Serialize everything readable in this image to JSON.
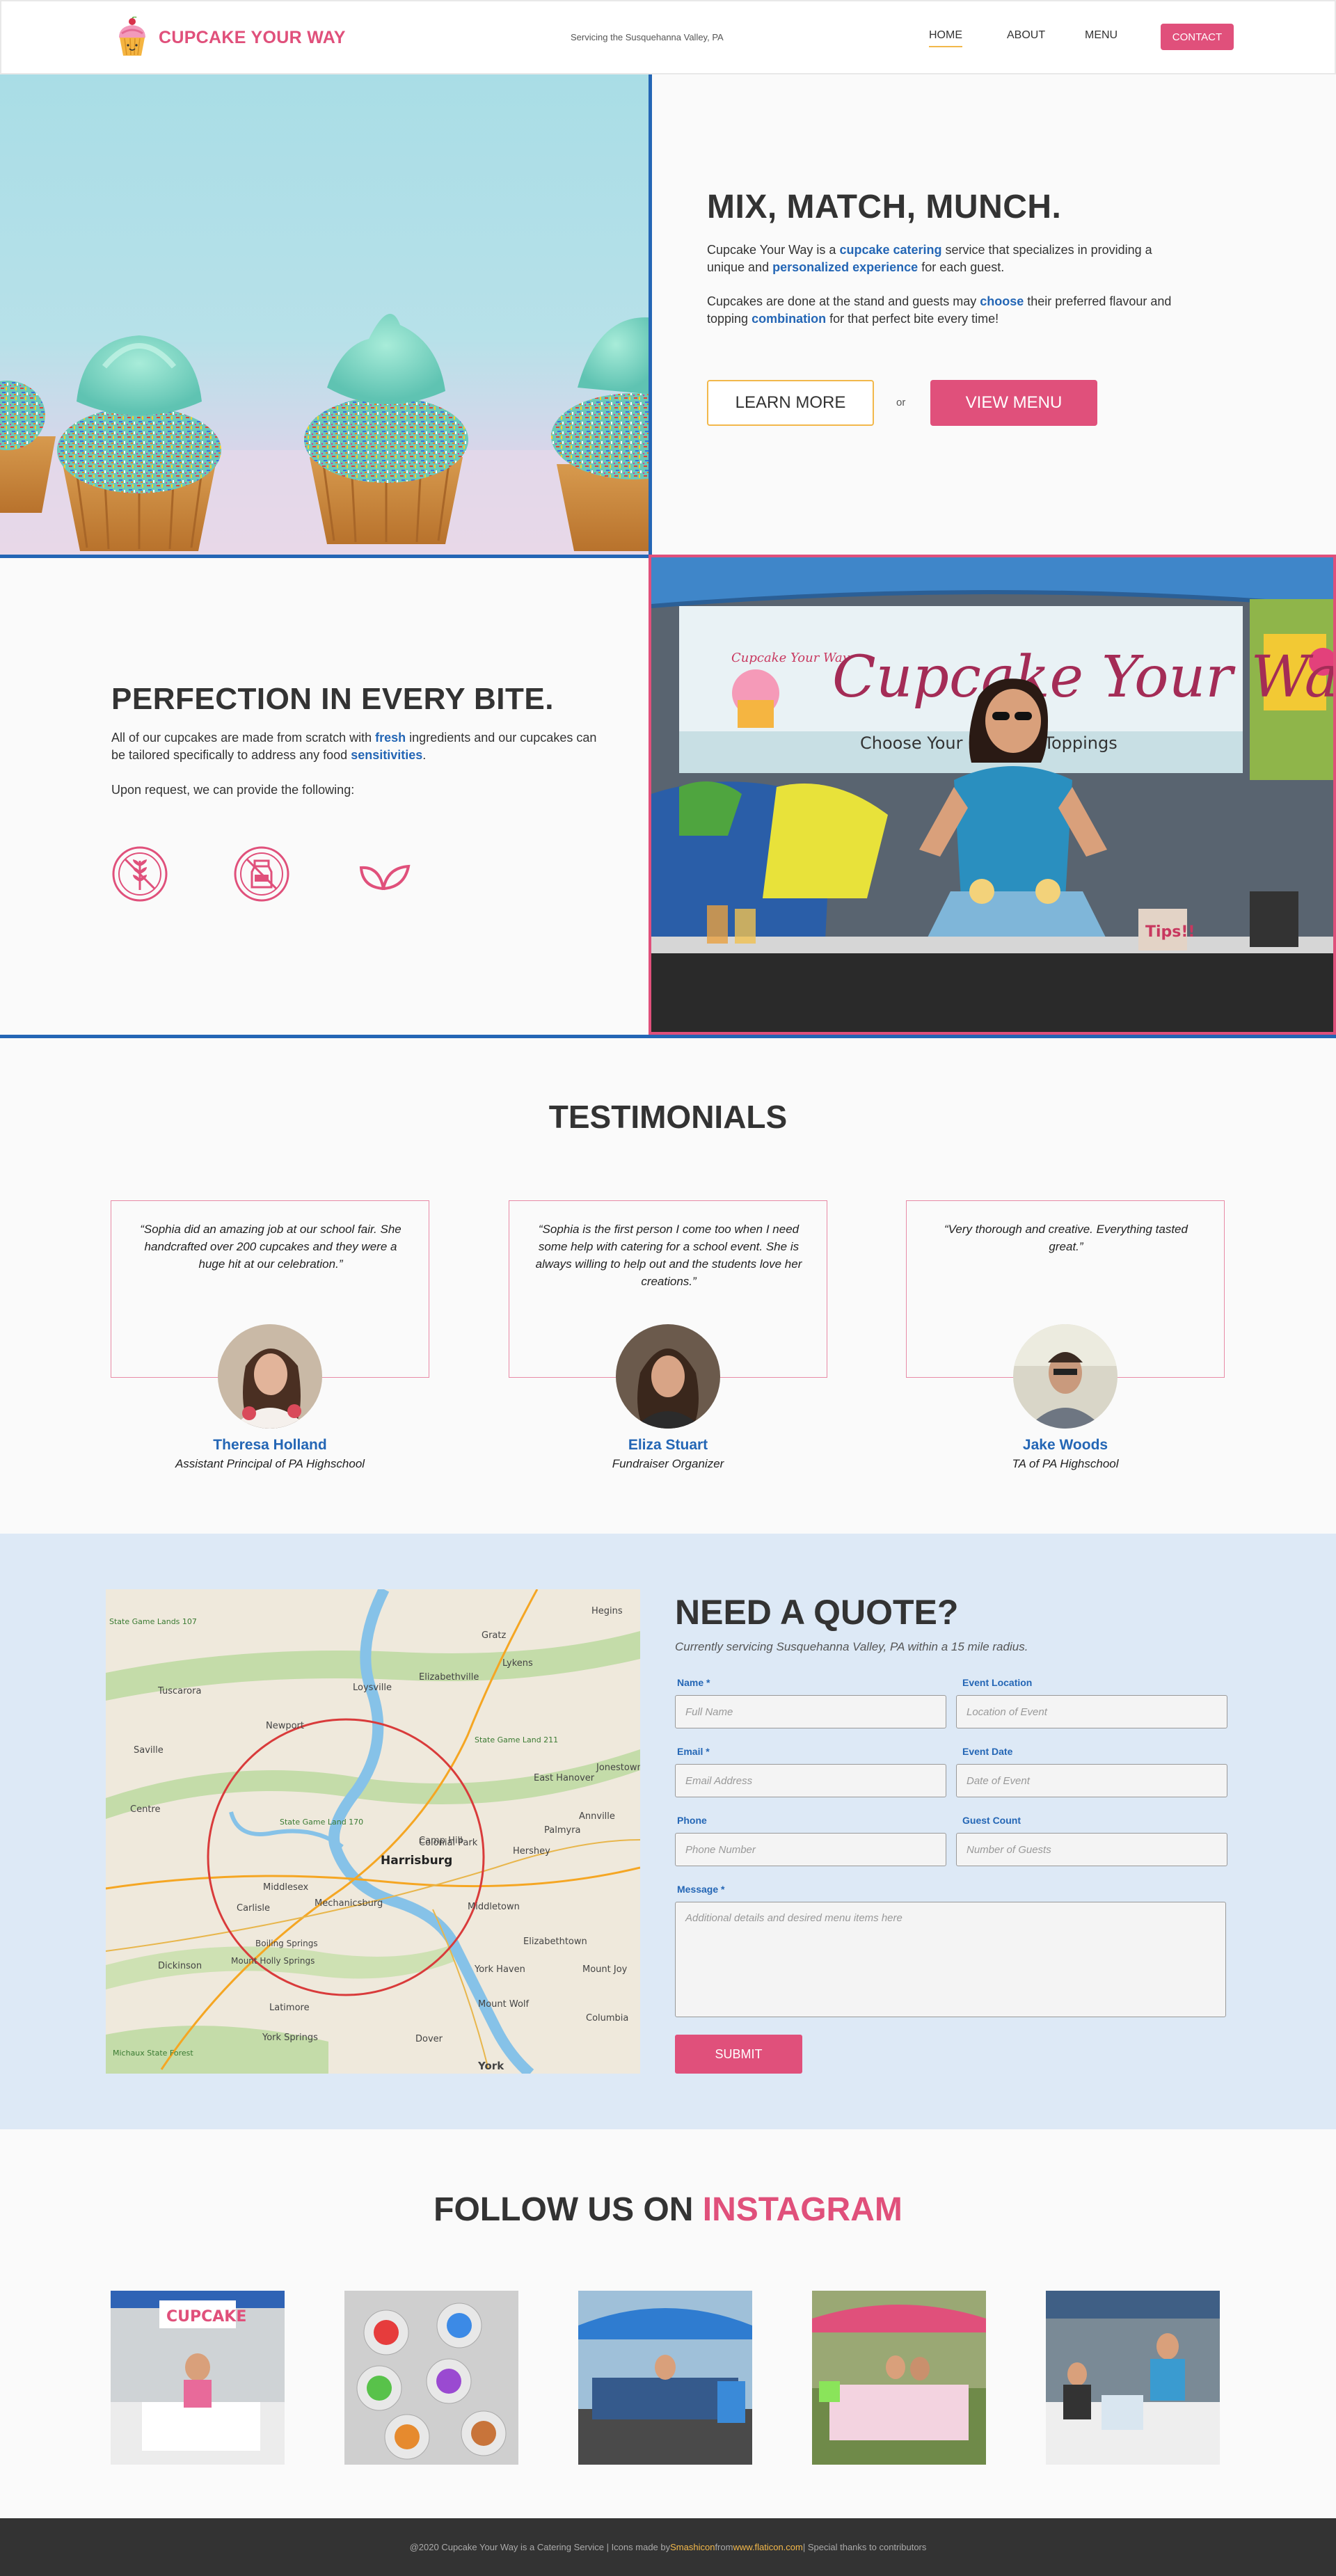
{
  "header": {
    "brand": "CUPCAKE YOUR WAY",
    "tagline": "Servicing the Susquehanna Valley, PA",
    "nav": {
      "home": "HOME",
      "about": "ABOUT",
      "menu": "MENU",
      "contact": "CONTACT"
    }
  },
  "hero": {
    "title": "MIX, MATCH, MUNCH.",
    "p1": {
      "t1": "Cupcake Your Way is a ",
      "h1": "cupcake catering",
      "t2": " service that specializes in providing a unique and ",
      "h2": "personalized experience",
      "t3": " for each guest."
    },
    "p2": {
      "t1": "Cupcakes are done at the stand and guests may ",
      "h1": "choose",
      "t2": " their preferred flavour and topping ",
      "h2": "combination",
      "t3": " for that perfect bite every time!"
    },
    "learn_more": "LEARN MORE",
    "or": "or",
    "view_menu": "VIEW MENU"
  },
  "perfection": {
    "title": "PERFECTION IN EVERY BITE.",
    "p1": {
      "t1": "All of our cupcakes are made from scratch with ",
      "h1": "fresh",
      "t2": " ingredients and our cupcakes can be tailored specifically to address any food ",
      "h2": "sensitivities",
      "t3": "."
    },
    "p2": "Upon request, we can provide the following:",
    "icons": [
      "gluten-free-icon",
      "dairy-free-icon",
      "vegan-leaf-icon"
    ],
    "banner_logo_text": "Cupcake Your Way",
    "banner_script": "Cupcake Your Way",
    "banner_line": "Choose Your Flavor + Toppings"
  },
  "testimonials": {
    "title": "TESTIMONIALS",
    "items": [
      {
        "quote": "“Sophia did an amazing job at our school fair. She handcrafted over 200 cupcakes and they were a huge hit at our celebration.”",
        "name": "Theresa Holland",
        "role": "Assistant Principal of PA Highschool"
      },
      {
        "quote": "“Sophia is the first person I come too when I need some help with catering for a school event. She is always willing to help out and the students love her creations.”",
        "name": "Eliza Stuart",
        "role": "Fundraiser Organizer"
      },
      {
        "quote": "“Very thorough and creative. Everything tasted great.”",
        "name": "Jake Woods",
        "role": "TA of PA Highschool"
      }
    ]
  },
  "quote": {
    "title": "NEED A QUOTE?",
    "subtitle": "Currently servicing Susquehanna Valley, PA within a 15 mile radius.",
    "fields": {
      "name": {
        "label": "Name *",
        "placeholder": "Full Name"
      },
      "location": {
        "label": "Event Location",
        "placeholder": "Location of Event"
      },
      "email": {
        "label": "Email *",
        "placeholder": "Email Address"
      },
      "date": {
        "label": "Event Date",
        "placeholder": "Date of Event"
      },
      "phone": {
        "label": "Phone",
        "placeholder": "Phone Number"
      },
      "guests": {
        "label": "Guest Count",
        "placeholder": "Number of Guests"
      },
      "message": {
        "label": "Message *",
        "placeholder": "Additional details and desired menu items here"
      }
    },
    "submit": "SUBMIT",
    "map_labels": [
      "Harrisburg",
      "Hershey",
      "Camp Hill",
      "Mechanicsburg",
      "Carlisle",
      "Middlesex",
      "Newport",
      "Elizabethville",
      "Lykens",
      "Gratz",
      "Hegins",
      "Tuscarora",
      "Saville",
      "Centre",
      "Loysville",
      "East Hanover",
      "Jonestown",
      "Palmyra",
      "Annville",
      "Colonial Park",
      "Middletown",
      "Elizabethtown",
      "York Haven",
      "Mount Joy",
      "Mount Wolf",
      "Columbia",
      "Dover",
      "York",
      "York Springs",
      "Latimore",
      "Mount Holly Springs",
      "Dickinson",
      "Boiling Springs",
      "State Game Land 170",
      "State Game Land 211",
      "State Game Lands 107",
      "Michaux State Forest"
    ]
  },
  "instagram": {
    "title_prefix": "FOLLOW US ON ",
    "title_highlight": "INSTAGRAM",
    "sign_text": "CUPCAKE"
  },
  "footer": {
    "t1": "@2020 Cupcake Your Way is a Catering Service | Icons made by ",
    "author": "Smashicon",
    "t2": " from ",
    "site": "www.flaticon.com",
    "t3": " | Special thanks to contributors"
  },
  "colors": {
    "brand_pink": "#e0507b",
    "accent_blue": "#2466b5",
    "accent_yellow": "#f2b84b",
    "quote_bg": "#dde9f6",
    "footer_bg": "#333333"
  }
}
